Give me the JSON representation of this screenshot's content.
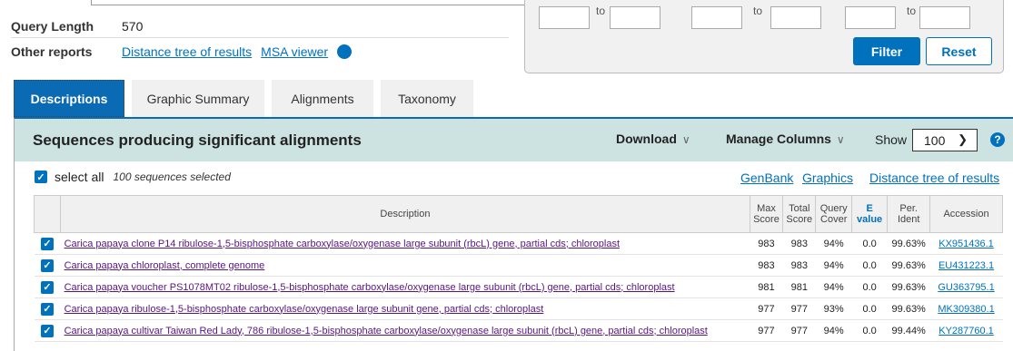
{
  "summary": {
    "query_length_label": "Query Length",
    "query_length_value": "570",
    "other_reports_label": "Other reports",
    "links": [
      "Distance tree of results",
      "MSA viewer"
    ],
    "help_glyph": "?"
  },
  "filter": {
    "to_label": "to",
    "filter_button": "Filter",
    "reset_button": "Reset"
  },
  "tabs": [
    "Descriptions",
    "Graphic Summary",
    "Alignments",
    "Taxonomy"
  ],
  "header": {
    "title": "Sequences producing significant alignments",
    "download": "Download",
    "manage_columns": "Manage Columns",
    "show_label": "Show",
    "show_value": "100"
  },
  "select_bar": {
    "select_all": "select all",
    "selected_count": "100 sequences selected",
    "links": [
      "GenBank",
      "Graphics",
      "Distance tree of results"
    ]
  },
  "table": {
    "columns": {
      "description": "Description",
      "max_score": [
        "Max",
        "Score"
      ],
      "total_score": [
        "Total",
        "Score"
      ],
      "query_cover": [
        "Query",
        "Cover"
      ],
      "e_value": [
        "E",
        "value"
      ],
      "per_ident": [
        "Per.",
        "Ident"
      ],
      "accession": "Accession"
    },
    "rows": [
      {
        "description": "Carica papaya clone P14 ribulose-1,5-bisphosphate carboxylase/oxygenase large subunit (rbcL) gene, partial cds; chloroplast",
        "max": "983",
        "total": "983",
        "cover": "94%",
        "e": "0.0",
        "ident": "99.63%",
        "accession": "KX951436.1"
      },
      {
        "description": "Carica papaya chloroplast, complete genome",
        "max": "983",
        "total": "983",
        "cover": "94%",
        "e": "0.0",
        "ident": "99.63%",
        "accession": "EU431223.1"
      },
      {
        "description": "Carica papaya voucher PS1078MT02 ribulose-1,5-bisphosphate carboxylase/oxygenase large subunit (rbcL) gene, partial cds; chloroplast",
        "max": "981",
        "total": "981",
        "cover": "94%",
        "e": "0.0",
        "ident": "99.63%",
        "accession": "GU363795.1"
      },
      {
        "description": "Carica papaya ribulose-1,5-bisphosphate carboxylase/oxygenase large subunit gene, partial cds; chloroplast",
        "max": "977",
        "total": "977",
        "cover": "93%",
        "e": "0.0",
        "ident": "99.63%",
        "accession": "MK309380.1"
      },
      {
        "description": "Carica papaya cultivar Taiwan Red Lady, 786 ribulose-1,5-bisphosphate carboxylase/oxygenase large subunit (rbcL) gene, partial cds; chloroplast",
        "max": "977",
        "total": "977",
        "cover": "94%",
        "e": "0.0",
        "ident": "99.44%",
        "accession": "KY287760.1"
      }
    ]
  },
  "colors": {
    "accent": "#0071bc",
    "tab_active": "#0b6ab4",
    "header_bg": "#cde3e2",
    "visited_link": "#58167d"
  }
}
